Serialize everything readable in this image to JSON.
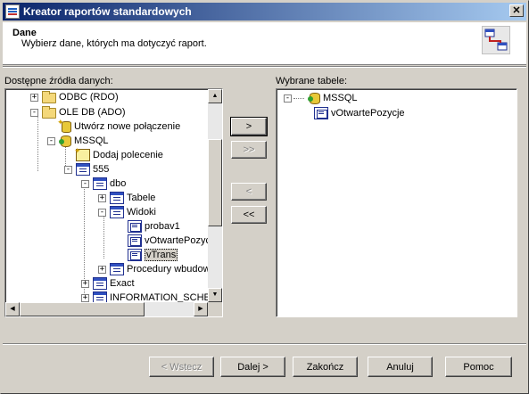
{
  "window": {
    "title": "Kreator raportów standardowych",
    "close_label": "✕"
  },
  "header": {
    "title": "Dane",
    "subtitle": "Wybierz dane, których ma dotyczyć raport."
  },
  "left_panel": {
    "label": "Dostępne źródła danych:",
    "tree": [
      {
        "label": "ODBC (RDO)",
        "icon": "folder-icon",
        "expander": "+"
      },
      {
        "label": "OLE DB (ADO)",
        "icon": "folder-icon",
        "expander": "-"
      },
      {
        "label": "Utwórz nowe połączenie",
        "icon": "new-connection-icon",
        "expander": ""
      },
      {
        "label": "MSSQL",
        "icon": "database-icon",
        "expander": "-"
      },
      {
        "label": "Dodaj polecenie",
        "icon": "add-command-icon",
        "expander": ""
      },
      {
        "label": "555",
        "icon": "table-icon",
        "expander": "-"
      },
      {
        "label": "dbo",
        "icon": "table-icon",
        "expander": "-"
      },
      {
        "label": "Tabele",
        "icon": "table-icon",
        "expander": "+"
      },
      {
        "label": "Widoki",
        "icon": "table-icon",
        "expander": "-"
      },
      {
        "label": "probav1",
        "icon": "view-icon",
        "expander": ""
      },
      {
        "label": "vOtwartePozycje",
        "icon": "view-icon",
        "expander": ""
      },
      {
        "label": "vTrans",
        "icon": "view-icon",
        "expander": "",
        "selected": true
      },
      {
        "label": "Procedury wbudowane",
        "icon": "table-icon",
        "expander": "+"
      },
      {
        "label": "Exact",
        "icon": "table-icon",
        "expander": "+"
      },
      {
        "label": "INFORMATION_SCHEMA",
        "icon": "table-icon",
        "expander": "+"
      }
    ]
  },
  "transfer_buttons": {
    "add": ">",
    "add_all": ">>",
    "remove": "<",
    "remove_all": "<<"
  },
  "right_panel": {
    "label": "Wybrane tabele:",
    "tree": [
      {
        "label": "MSSQL",
        "icon": "database-icon",
        "expander": "-"
      },
      {
        "label": "vOtwartePozycje",
        "icon": "view-icon",
        "expander": ""
      }
    ]
  },
  "footer": {
    "back": "< Wstecz",
    "next": "Dalej >",
    "finish": "Zakończ",
    "cancel": "Anuluj",
    "help": "Pomoc"
  }
}
